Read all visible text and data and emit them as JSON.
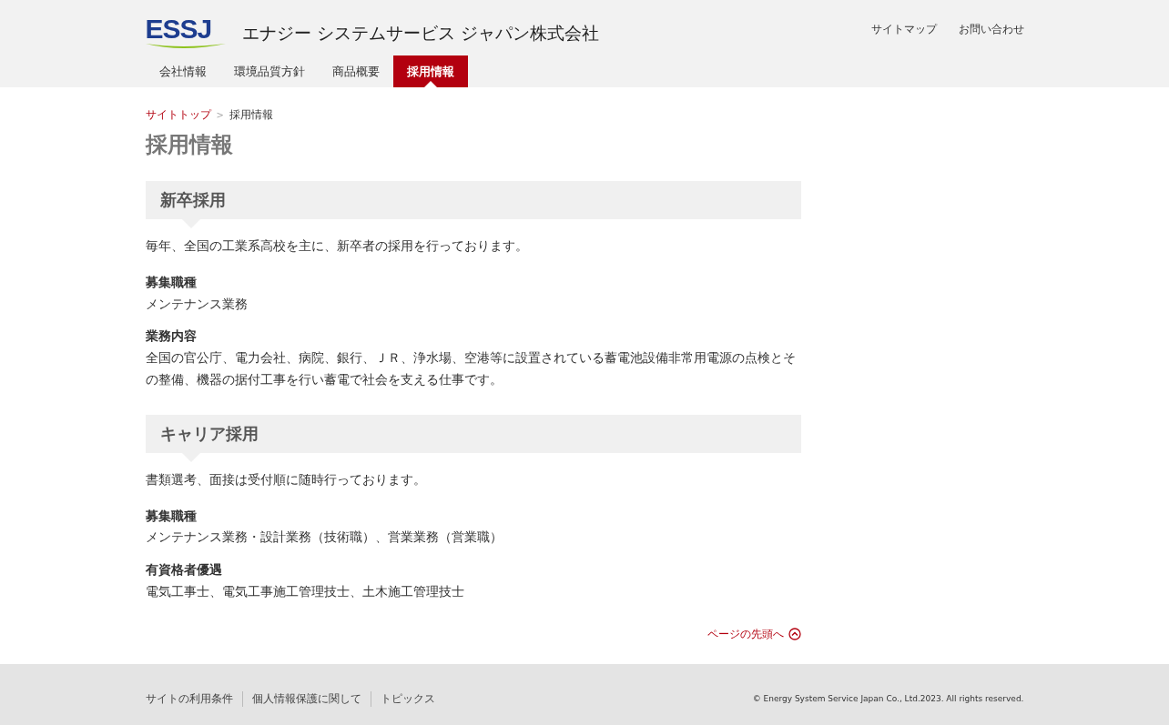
{
  "header": {
    "logo_text": "ESSJ",
    "company_name": "エナジー システムサービス ジャパン株式会社",
    "utility_links": [
      "サイトマップ",
      "お問い合わせ"
    ]
  },
  "nav": [
    {
      "label": "会社情報",
      "selected": false
    },
    {
      "label": "環境品質方針",
      "selected": false
    },
    {
      "label": "商品概要",
      "selected": false
    },
    {
      "label": "採用情報",
      "selected": true
    }
  ],
  "breadcrumb": [
    "サイトトップ",
    "採用情報"
  ],
  "breadcrumb_separator": ">",
  "page_title": "採用情報",
  "sections": [
    {
      "heading": "新卒採用",
      "intro": "毎年、全国の工業系高校を主に、新卒者の採用を行っております。",
      "items": [
        {
          "label": "募集職種",
          "value": "メンテナンス業務"
        },
        {
          "label": "業務内容",
          "value": "全国の官公庁、電力会社、病院、銀行、ＪＲ、浄水場、空港等に設置されている蓄電池設備非常用電源の点検とその整備、機器の据付工事を行い蓄電で社会を支える仕事です。"
        }
      ]
    },
    {
      "heading": "キャリア採用",
      "intro": "書類選考、面接は受付順に随時行っております。",
      "items": [
        {
          "label": "募集職種",
          "value": "メンテナンス業務・設計業務（技術職）、営業業務（営業職）"
        },
        {
          "label": "有資格者優遇",
          "value": "電気工事士、電気工事施工管理技士、土木施工管理技士"
        }
      ]
    }
  ],
  "page_top_link": "ページの先頭へ",
  "footer": {
    "links": [
      "サイトの利用条件",
      "個人情報保護に関して",
      "トピックス"
    ],
    "copyright": "© Energy System Service Japan Co., Ltd.2023. All rights reserved."
  }
}
